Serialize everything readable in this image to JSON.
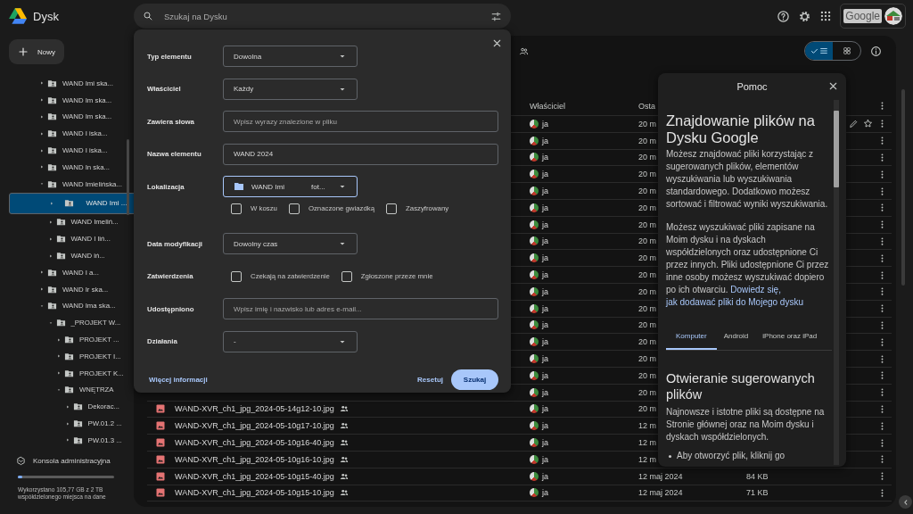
{
  "top_bar": {
    "app_name": "Dysk",
    "search": {
      "placeholder": "Szukaj na Dysku"
    },
    "account_logo": "Google"
  },
  "sidebar": {
    "new_button": "Nowy",
    "tree": [
      {
        "label": "WAND Imi ska...",
        "expanded": false,
        "selected": false
      },
      {
        "label": "WAND Im ska...",
        "expanded": false,
        "selected": false
      },
      {
        "label": "WAND Im ska...",
        "expanded": false,
        "selected": false
      },
      {
        "label": "WAND I iska...",
        "expanded": false,
        "selected": false
      },
      {
        "label": "WAND I iska...",
        "expanded": false,
        "selected": false
      },
      {
        "label": "WAND In ska...",
        "expanded": false,
        "selected": false
      },
      {
        "label": "WAND Imielińska...",
        "expanded": true,
        "selected": false,
        "children": [
          {
            "label": "WAND Imi ...",
            "expanded": false,
            "selected": true
          },
          {
            "label": "WAND Imeliń...",
            "expanded": false,
            "selected": false
          },
          {
            "label": "WAND I liń...",
            "expanded": false,
            "selected": false
          },
          {
            "label": "WAND iń...",
            "expanded": false,
            "selected": false
          }
        ]
      },
      {
        "label": "WAND I a...",
        "expanded": false,
        "selected": false
      },
      {
        "label": "WAND Ir ska...",
        "expanded": false,
        "selected": false
      },
      {
        "label": "WAND Ima ska...",
        "expanded": true,
        "selected": false,
        "children": [
          {
            "label": "_PROJEKT W...",
            "expanded": true,
            "selected": false,
            "children": [
              {
                "label": "PROJEKT ...",
                "expanded": false,
                "selected": false
              },
              {
                "label": "PROJEKT I...",
                "expanded": false,
                "selected": false
              },
              {
                "label": "PROJEKT K...",
                "expanded": false,
                "selected": false
              },
              {
                "label": "WNĘTRZA",
                "expanded": true,
                "selected": false,
                "children": [
                  {
                    "label": "Dekorac...",
                    "expanded": false,
                    "selected": false
                  },
                  {
                    "label": "PW.01.2 ...",
                    "expanded": false,
                    "selected": false
                  },
                  {
                    "label": "PW.01.3 ...",
                    "expanded": false,
                    "selected": false
                  }
                ]
              }
            ]
          }
        ]
      }
    ],
    "admin_console": "Konsola administracyjna",
    "storage": {
      "level": 0.05,
      "text": "Wykorzystano 105,77 GB z 2 TB współdzielonego miejsca na dane"
    }
  },
  "main": {
    "view_toggle": [
      {
        "kind": "list",
        "selected": true
      },
      {
        "kind": "grid",
        "selected": false
      }
    ],
    "columns": [
      "Właściciel",
      "Osta"
    ],
    "rows": [
      {
        "owner": "ja",
        "modified": "20 m",
        "shared": false,
        "hovered": true
      },
      {
        "owner": "ja",
        "modified": "20 m",
        "shared": false,
        "hovered": false
      },
      {
        "owner": "ja",
        "modified": "20 m",
        "shared": false,
        "hovered": false
      },
      {
        "owner": "ja",
        "modified": "20 m",
        "shared": false,
        "hovered": false
      },
      {
        "owner": "ja",
        "modified": "20 m",
        "shared": false,
        "hovered": false
      },
      {
        "owner": "ja",
        "modified": "20 m",
        "shared": false,
        "hovered": false
      },
      {
        "owner": "ja",
        "modified": "20 m",
        "shared": false,
        "hovered": false
      },
      {
        "owner": "ja",
        "modified": "20 m",
        "shared": false,
        "hovered": false
      },
      {
        "owner": "ja",
        "modified": "20 m",
        "shared": false,
        "hovered": false
      },
      {
        "owner": "ja",
        "modified": "20 m",
        "shared": false,
        "hovered": false
      },
      {
        "owner": "ja",
        "modified": "20 m",
        "shared": false,
        "hovered": false
      },
      {
        "owner": "ja",
        "modified": "20 m",
        "shared": false,
        "hovered": false
      },
      {
        "owner": "ja",
        "modified": "20 m",
        "shared": false,
        "hovered": false
      },
      {
        "owner": "ja",
        "modified": "20 m",
        "shared": false,
        "hovered": false
      },
      {
        "owner": "ja",
        "modified": "20 m",
        "shared": false,
        "hovered": false
      },
      {
        "owner": "ja",
        "modified": "20 m",
        "shared": false,
        "hovered": false
      },
      {
        "owner": "ja",
        "modified": "20 m",
        "shared": false,
        "hovered": false
      },
      {
        "name": "WAND-XVR_ch1_jpg_2024-05-14g12-10.jpg",
        "owner": "ja",
        "modified": "20 m",
        "shared": true,
        "hovered": false
      },
      {
        "name": "WAND-XVR_ch1_jpg_2024-05-10g17-10.jpg",
        "owner": "ja",
        "modified": "12 m",
        "shared": true,
        "hovered": false
      },
      {
        "name": "WAND-XVR_ch1_jpg_2024-05-10g16-40.jpg",
        "owner": "ja",
        "modified": "12 m",
        "shared": true,
        "hovered": false
      },
      {
        "name": "WAND-XVR_ch1_jpg_2024-05-10g16-10.jpg",
        "owner": "ja",
        "modified": "12 m",
        "shared": true,
        "hovered": false
      },
      {
        "name": "WAND-XVR_ch1_jpg_2024-05-10g15-40.jpg",
        "owner": "ja",
        "modified": "12 maj 2024",
        "size": "84 KB",
        "shared": true,
        "hovered": false
      },
      {
        "name": "WAND-XVR_ch1_jpg_2024-05-10g15-10.jpg",
        "owner": "ja",
        "modified": "12 maj 2024",
        "size": "71 KB",
        "shared": true,
        "hovered": false
      }
    ]
  },
  "search_dialog": {
    "fields": [
      {
        "kind": "select",
        "label": "Typ elementu",
        "value": "Dowolna"
      },
      {
        "kind": "select",
        "label": "Właściciel",
        "value": "Każdy"
      },
      {
        "kind": "input",
        "label": "Zawiera słowa",
        "placeholder": "Wpisz wyrazy znalezione w pliku"
      },
      {
        "kind": "input",
        "label": "Nazwa elementu",
        "value": "WAND 2024"
      },
      {
        "kind": "location",
        "label": "Lokalizacja",
        "value_parts": [
          "WAND Imi",
          "fot..."
        ],
        "focused": true
      },
      {
        "kind": "checkboxes",
        "options": [
          {
            "label": "W koszu",
            "checked": false
          },
          {
            "label": "Oznaczone gwiazdką",
            "checked": false
          },
          {
            "label": "Zaszyfrowany",
            "checked": false
          }
        ]
      },
      {
        "kind": "select",
        "label": "Data modyfikacji",
        "value": "Dowolny czas"
      },
      {
        "kind": "checkboxes",
        "label": "Zatwierdzenia",
        "options": [
          {
            "label": "Czekają na zatwierdzenie",
            "checked": false
          },
          {
            "label": "Zgłoszone przeze mnie",
            "checked": false
          }
        ]
      },
      {
        "kind": "input",
        "label": "Udostępniono",
        "placeholder": "Wpisz imię i nazwisko lub adres e-mail..."
      },
      {
        "kind": "select",
        "label": "Działania",
        "value": "-"
      }
    ],
    "more_link": "Więcej informacji",
    "reset": "Resetuj",
    "search": "Szukaj"
  },
  "help_panel": {
    "title": "Pomoc",
    "heading": "Znajdowanie plików na Dysku Google",
    "paragraphs": [
      "Możesz znajdować pliki korzystając z sugerowanych plików, elementów wyszukiwania lub wyszukiwania standardowego. Dodatkowo możesz sortować i filtrować wyniki wyszukiwania."
    ],
    "paragraph_with_link": {
      "text": "Możesz wyszukiwać pliki zapisane na Moim dysku i na dyskach współdzielonych oraz udostępnione Ci przez innych. Pliki udostępnione Ci przez inne osoby możesz wyszukiwać dopiero po ich otwarciu.",
      "link_parts": [
        "Dowiedz się,",
        "jak dodawać pliki do Mojego dysku"
      ]
    },
    "tabs": [
      {
        "label": "Komputer",
        "selected": true
      },
      {
        "label": "Android",
        "selected": false
      },
      {
        "label": "iPhone oraz iPad",
        "selected": false
      }
    ],
    "subheading": "Otwieranie sugerowanych plików",
    "body": "Najnowsze i istotne pliki są dostępne na Stronie głównej oraz na Moim dysku i dyskach współdzielonych.",
    "bullets": [
      "Aby otworzyć plik, kliknij go"
    ]
  }
}
